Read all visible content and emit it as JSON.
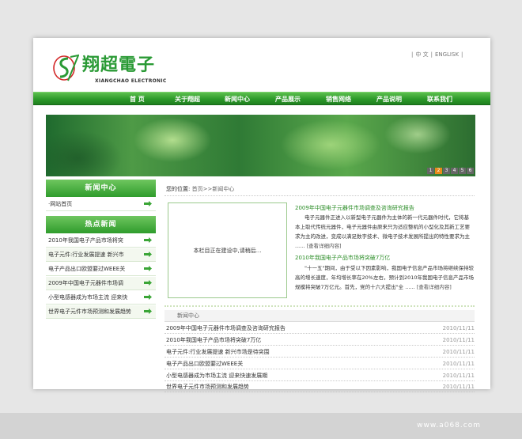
{
  "header": {
    "logo_cn": "翔超電子",
    "logo_en": "XIANGCHAO ELECTRONIC",
    "lang": [
      "中 文",
      "ENGLISK"
    ]
  },
  "nav": [
    "首 页",
    "关于翔超",
    "新闻中心",
    "产品展示",
    "销售网络",
    "产品说明",
    "联系我们"
  ],
  "banner": {
    "pages": [
      "1",
      "2",
      "3",
      "4",
      "5",
      "6"
    ],
    "active": "2"
  },
  "sidebar": {
    "news_center_title": "新闻中心",
    "news_center_items": [
      "网站首页"
    ],
    "hot_news_title": "热点新闻",
    "hot_news_items": [
      "2010年我国电子产品市场将突",
      "电子元件:行业发展提速 新兴市",
      "电子产品出口欧盟要过WEEE关",
      "2009年中国电子元器件市场调",
      "小型电感器成为市场主流 迎来快",
      "世界电子元件市场预测和发展趋势"
    ]
  },
  "breadcrumb": {
    "label": "您的位置:",
    "path": "首页>>新闻中心"
  },
  "notice": "本栏目正在建设中,请稍后...",
  "featured": [
    {
      "title": "2009年中国电子元器件市场调查及咨询研究报告",
      "body": "电子元器件正进入以新型电子元器件为主体的新一代元器件时代，它将基本上取代传统元器件，电子元器件由原来只为适应整机的小型化及其新工艺要求为主的改进，变成以满足数字技术、微电子技术发展所提出的特性要求为主 ......",
      "more": "[查看详细内容]"
    },
    {
      "title": "2010年我国电子产品市场将突破7万亿",
      "body": "\"十一五\"期间，由于受以下因素影响，我国电子信息产品市场将继续保持较高的增长速度，年均增长率在20%左右，预计到2010年我国电子信息产品市场规模将突破7万亿元。首先，党的十六大提出\"全 ......",
      "more": "[查看详细内容]"
    }
  ],
  "news_list": {
    "title": "新闻中心",
    "rows": [
      {
        "title": "2009年中国电子元器件市场调查及咨询研究报告",
        "date": "2010/11/11"
      },
      {
        "title": "2010年我国电子产品市场将突破7万亿",
        "date": "2010/11/11"
      },
      {
        "title": "电子元件:行业发展提速 新兴市场是待突围",
        "date": "2010/11/11"
      },
      {
        "title": "电子产品出口欧盟要过WEEE关",
        "date": "2010/11/11"
      },
      {
        "title": "小型电感器成为市场主流 迎来快速发展期",
        "date": "2010/11/11"
      },
      {
        "title": "世界电子元件市场预测和发展趋势",
        "date": "2010/11/11"
      }
    ]
  },
  "watermark": "www.a068.com",
  "colors": {
    "brand_green": "#2a9a35",
    "accent_orange": "#e98a1a"
  }
}
